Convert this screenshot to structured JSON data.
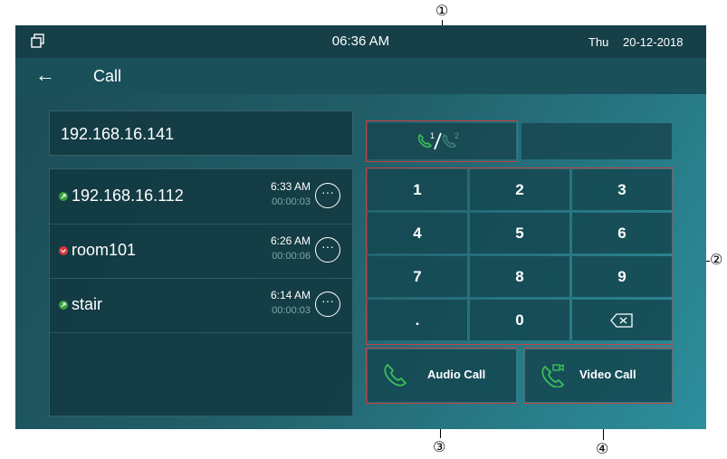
{
  "status_bar": {
    "time": "06:36 AM",
    "day": "Thu",
    "date": "20-12-2018"
  },
  "title_bar": {
    "back_glyph": "←",
    "title": "Call"
  },
  "ip_input": {
    "value": "192.168.16.141"
  },
  "call_history": [
    {
      "name": "192.168.16.112",
      "time": "6:33 AM",
      "duration": "00:00:03",
      "status": "outgoing",
      "status_color": "#3aa03a"
    },
    {
      "name": "room101",
      "time": "6:26 AM",
      "duration": "00:00:06",
      "status": "missed",
      "status_color": "#d8363c"
    },
    {
      "name": "stair",
      "time": "6:14 AM",
      "duration": "00:00:03",
      "status": "outgoing",
      "status_color": "#3aa03a"
    }
  ],
  "more_glyph": "···",
  "line_switch": {
    "icon": "phone-line-1-2-icon"
  },
  "keypad": [
    "1",
    "2",
    "3",
    "4",
    "5",
    "6",
    "7",
    "8",
    "9",
    ".",
    "0",
    "⌫"
  ],
  "buttons": {
    "audio_call": "Audio Call",
    "video_call": "Video Call"
  },
  "annotations": [
    "①",
    "②",
    "③",
    "④"
  ],
  "colors": {
    "accent_green": "#3bbf5a",
    "missed_red": "#d8363c",
    "panel": "#1a505a"
  }
}
